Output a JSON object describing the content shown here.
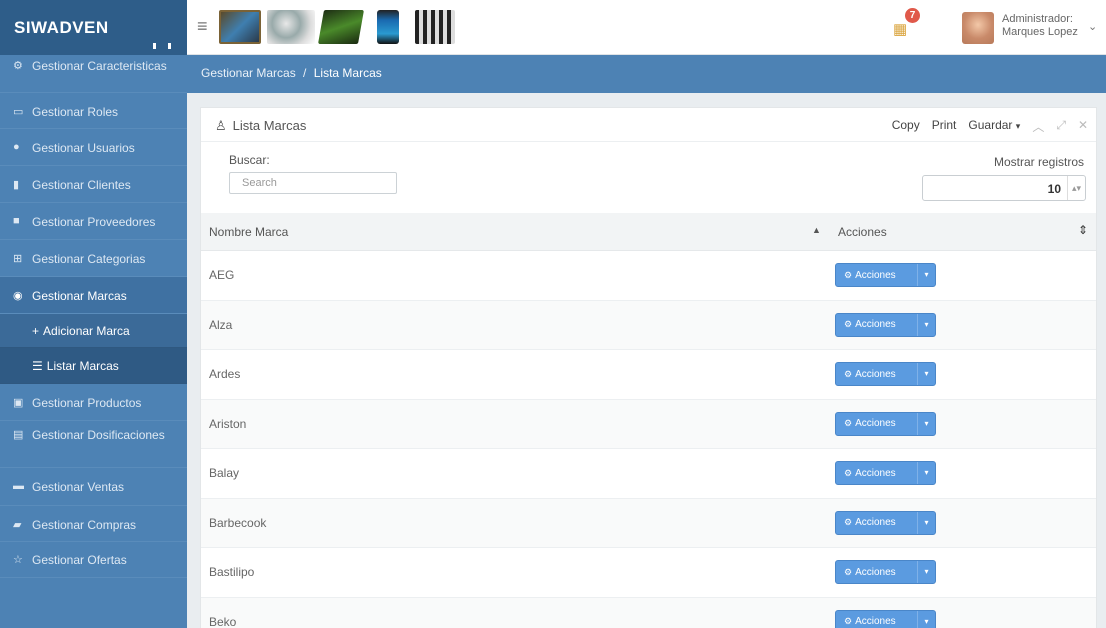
{
  "brand": "SIWADVEN",
  "topbar": {
    "notification_count": "7",
    "user_role": "Administrador:",
    "user_name": "Marques Lopez"
  },
  "sidebar": {
    "items": [
      {
        "label": "Gestionar Caracteristicas",
        "icon": "cogs-icon"
      },
      {
        "label": "Gestionar Roles",
        "icon": "card-icon"
      },
      {
        "label": "Gestionar Usuarios",
        "icon": "users-icon"
      },
      {
        "label": "Gestionar Clientes",
        "icon": "clients-icon"
      },
      {
        "label": "Gestionar Proveedores",
        "icon": "truck-icon"
      },
      {
        "label": "Gestionar Categorias",
        "icon": "sitemap-icon"
      },
      {
        "label": "Gestionar Marcas",
        "icon": "globe-icon"
      },
      {
        "label": "Gestionar Productos",
        "icon": "box-icon"
      },
      {
        "label": "Gestionar Dosificaciones",
        "icon": "file-icon"
      },
      {
        "label": "Gestionar Ventas",
        "icon": "cart-icon"
      },
      {
        "label": "Gestionar Compras",
        "icon": "book-icon"
      },
      {
        "label": "Gestionar Ofertas",
        "icon": "star-icon"
      }
    ],
    "sub_items": [
      {
        "label": "Adicionar Marca",
        "icon": "plus-icon"
      },
      {
        "label": "Listar Marcas",
        "icon": "list-icon"
      }
    ]
  },
  "breadcrumb": {
    "parent": "Gestionar Marcas",
    "separator": "/",
    "current": "Lista Marcas"
  },
  "panel": {
    "title": "Lista Marcas",
    "tools": {
      "copy": "Copy",
      "print": "Print",
      "save": "Guardar"
    }
  },
  "filters": {
    "search_label": "Buscar:",
    "search_placeholder": "Search",
    "records_label": "Mostrar registros",
    "records_value": "10"
  },
  "table": {
    "columns": [
      "Nombre Marca",
      "Acciones"
    ],
    "action_label": "Acciones",
    "rows": [
      "AEG",
      "Alza",
      "Ardes",
      "Ariston",
      "Balay",
      "Barbecook",
      "Bastilipo",
      "Beko"
    ]
  },
  "colors": {
    "brand_bg": "#2e5d89",
    "sidebar_bg": "#4d82b4",
    "action_button": "#5b9be0",
    "badge": "#e0594a"
  }
}
